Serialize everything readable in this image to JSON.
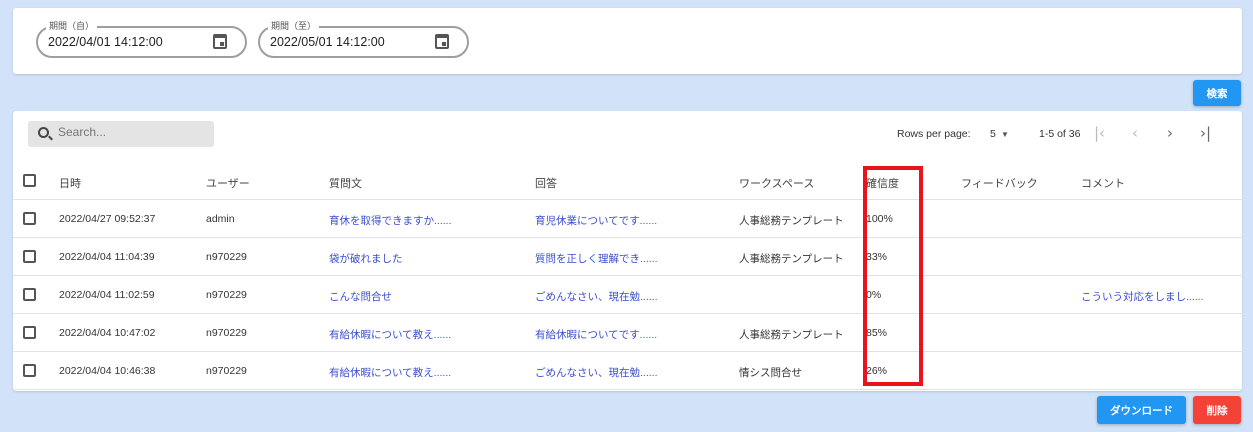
{
  "filters": {
    "from": {
      "label": "期間（自）",
      "value": "2022/04/01 14:12:00"
    },
    "to": {
      "label": "期間（至）",
      "value": "2022/05/01 14:12:00"
    },
    "search_button": "検索"
  },
  "toolbar": {
    "search_placeholder": "Search...",
    "rows_per_page_label": "Rows per page:",
    "rows_per_page": "5",
    "range": "1-5 of 36"
  },
  "table": {
    "headers": [
      "日時",
      "ユーザー",
      "質問文",
      "回答",
      "ワークスペース",
      "確信度",
      "フィードバック",
      "コメント"
    ],
    "rows": [
      [
        "2022/04/27 09:52:37",
        "admin",
        "育休を取得できますか......",
        "育児休業についてです......",
        "人事総務テンプレート",
        "100%",
        "",
        ""
      ],
      [
        "2022/04/04 11:04:39",
        "n970229",
        "袋が破れました",
        "質問を正しく理解でき......",
        "人事総務テンプレート",
        "33%",
        "",
        ""
      ],
      [
        "2022/04/04 11:02:59",
        "n970229",
        "こんな問合せ",
        "ごめんなさい、現在勉......",
        "",
        "0%",
        "",
        "こういう対応をしまし......"
      ],
      [
        "2022/04/04 10:47:02",
        "n970229",
        "有給休暇について教え......",
        "有給休暇についてです......",
        "人事総務テンプレート",
        "85%",
        "",
        ""
      ],
      [
        "2022/04/04 10:46:38",
        "n970229",
        "有給休暇について教え......",
        "ごめんなさい、現在勉......",
        "情シス問合せ",
        "26%",
        "",
        ""
      ]
    ]
  },
  "actions": {
    "download": "ダウンロード",
    "delete": "削除"
  },
  "colors": {
    "primary": "#2196f3",
    "danger": "#f44336",
    "highlight": "#e8141c"
  }
}
